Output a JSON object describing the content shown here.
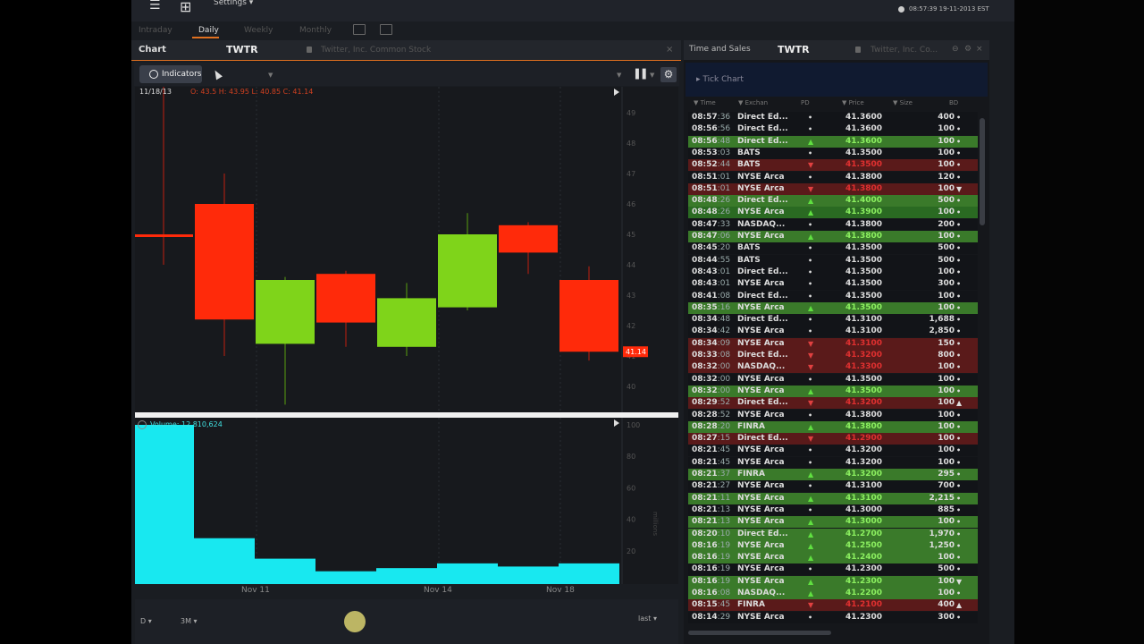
{
  "topbar": {
    "settings_label": "Settings",
    "clock": "08:57:39 19-11-2013 EST"
  },
  "range_tabs": [
    "Intraday",
    "Daily",
    "Weekly",
    "Monthly"
  ],
  "chart_panel": {
    "title": "Chart",
    "symbol": "TWTR",
    "description": "Twitter, Inc. Common Stock",
    "indicators_label": "Indicators",
    "date": "11/18/13",
    "ohlc": "O: 43.5 H: 43.95 L: 40.85 C: 41.14",
    "volume_label": "Volume: 12,810,624",
    "last_price_tag": "41.14",
    "x_labels": [
      "Nov 11",
      "Nov 14",
      "Nov 18"
    ],
    "volume_ticks": [
      "100",
      "80",
      "60",
      "40",
      "20"
    ],
    "volume_unit": "millions",
    "price_ticks": [
      "49",
      "48",
      "47",
      "46",
      "45",
      "44",
      "43",
      "42",
      "41",
      "40"
    ],
    "period_select": "D",
    "range_select": "3M",
    "mode_select": "last"
  },
  "chart_data": {
    "type": "candlestick",
    "ylim": [
      39.5,
      49.5
    ],
    "candles": [
      {
        "o": 45.0,
        "h": 50.0,
        "l": 44.0,
        "c": 45.0
      },
      {
        "o": 46.0,
        "h": 47.0,
        "l": 41.0,
        "c": 42.2
      },
      {
        "o": 41.4,
        "h": 43.6,
        "l": 39.4,
        "c": 43.5
      },
      {
        "o": 43.7,
        "h": 43.8,
        "l": 41.3,
        "c": 42.1
      },
      {
        "o": 41.3,
        "h": 43.4,
        "l": 41.0,
        "c": 42.9
      },
      {
        "o": 42.6,
        "h": 45.7,
        "l": 42.5,
        "c": 45.0
      },
      {
        "o": 45.3,
        "h": 45.4,
        "l": 43.7,
        "c": 44.4
      },
      {
        "o": 43.5,
        "h": 43.95,
        "l": 40.85,
        "c": 41.14
      }
    ],
    "volume": [
      100,
      28,
      15,
      7,
      9,
      12,
      10,
      12
    ]
  },
  "ts_panel": {
    "title": "Time and Sales",
    "symbol": "TWTR",
    "description": "Twitter, Inc. Co...",
    "tick_chart": "Tick Chart",
    "columns": [
      "Time",
      "Exchan",
      "PD",
      "Price",
      "Size",
      "BD"
    ],
    "rows": [
      {
        "t": "08:57",
        "s": ":36",
        "ex": "Direct Ed...",
        "pd": "•",
        "price": "41.3600",
        "size": "400",
        "bd": "•",
        "k": "nm"
      },
      {
        "t": "08:56",
        "s": ":56",
        "ex": "Direct Ed...",
        "pd": "•",
        "price": "41.3600",
        "size": "100",
        "bd": "•",
        "k": "nm"
      },
      {
        "t": "08:56",
        "s": ":48",
        "ex": "Direct Ed...",
        "pd": "▲",
        "price": "41.3600",
        "size": "100",
        "bd": "•",
        "k": "upB"
      },
      {
        "t": "08:53",
        "s": ":03",
        "ex": "BATS",
        "pd": "•",
        "price": "41.3500",
        "size": "100",
        "bd": "•",
        "k": "nm"
      },
      {
        "t": "08:52",
        "s": ":44",
        "ex": "BATS",
        "pd": "▼",
        "price": "41.3500",
        "size": "100",
        "bd": "•",
        "k": "dn"
      },
      {
        "t": "08:51",
        "s": ":01",
        "ex": "NYSE Arca",
        "pd": "•",
        "price": "41.3800",
        "size": "120",
        "bd": "•",
        "k": "nm"
      },
      {
        "t": "08:51",
        "s": ":01",
        "ex": "NYSE Arca",
        "pd": "▼",
        "price": "41.3800",
        "size": "100",
        "bd": "▼",
        "k": "dn"
      },
      {
        "t": "08:48",
        "s": ":26",
        "ex": "Direct Ed...",
        "pd": "▲",
        "price": "41.4000",
        "size": "500",
        "bd": "•",
        "k": "upB"
      },
      {
        "t": "08:48",
        "s": ":26",
        "ex": "NYSE Arca",
        "pd": "▲",
        "price": "41.3900",
        "size": "100",
        "bd": "•",
        "k": "up"
      },
      {
        "t": "08:47",
        "s": ":33",
        "ex": "NASDAQ...",
        "pd": "•",
        "price": "41.3800",
        "size": "200",
        "bd": "•",
        "k": "nm"
      },
      {
        "t": "08:47",
        "s": ":06",
        "ex": "NYSE Arca",
        "pd": "▲",
        "price": "41.3800",
        "size": "100",
        "bd": "•",
        "k": "upB"
      },
      {
        "t": "08:45",
        "s": ":20",
        "ex": "BATS",
        "pd": "•",
        "price": "41.3500",
        "size": "500",
        "bd": "•",
        "k": "nm"
      },
      {
        "t": "08:44",
        "s": ":55",
        "ex": "BATS",
        "pd": "•",
        "price": "41.3500",
        "size": "500",
        "bd": "•",
        "k": "nm"
      },
      {
        "t": "08:43",
        "s": ":01",
        "ex": "Direct Ed...",
        "pd": "•",
        "price": "41.3500",
        "size": "100",
        "bd": "•",
        "k": "nm"
      },
      {
        "t": "08:43",
        "s": ":01",
        "ex": "NYSE Arca",
        "pd": "•",
        "price": "41.3500",
        "size": "300",
        "bd": "•",
        "k": "nm"
      },
      {
        "t": "08:41",
        "s": ":08",
        "ex": "Direct Ed...",
        "pd": "•",
        "price": "41.3500",
        "size": "100",
        "bd": "•",
        "k": "nm"
      },
      {
        "t": "08:35",
        "s": ":16",
        "ex": "NYSE Arca",
        "pd": "▲",
        "price": "41.3500",
        "size": "100",
        "bd": "•",
        "k": "upB"
      },
      {
        "t": "08:34",
        "s": ":48",
        "ex": "Direct Ed...",
        "pd": "•",
        "price": "41.3100",
        "size": "1,688",
        "bd": "•",
        "k": "nm"
      },
      {
        "t": "08:34",
        "s": ":42",
        "ex": "NYSE Arca",
        "pd": "•",
        "price": "41.3100",
        "size": "2,850",
        "bd": "•",
        "k": "nm"
      },
      {
        "t": "08:34",
        "s": ":09",
        "ex": "NYSE Arca",
        "pd": "▼",
        "price": "41.3100",
        "size": "150",
        "bd": "•",
        "k": "dn"
      },
      {
        "t": "08:33",
        "s": ":08",
        "ex": "Direct Ed...",
        "pd": "▼",
        "price": "41.3200",
        "size": "800",
        "bd": "•",
        "k": "dn"
      },
      {
        "t": "08:32",
        "s": ":00",
        "ex": "NASDAQ...",
        "pd": "▼",
        "price": "41.3300",
        "size": "100",
        "bd": "•",
        "k": "dn"
      },
      {
        "t": "08:32",
        "s": ":00",
        "ex": "NYSE Arca",
        "pd": "•",
        "price": "41.3500",
        "size": "100",
        "bd": "•",
        "k": "nm"
      },
      {
        "t": "08:32",
        "s": ":00",
        "ex": "NYSE Arca",
        "pd": "▲",
        "price": "41.3500",
        "size": "100",
        "bd": "•",
        "k": "upB"
      },
      {
        "t": "08:29",
        "s": ":52",
        "ex": "Direct Ed...",
        "pd": "▼",
        "price": "41.3200",
        "size": "100",
        "bd": "▲",
        "k": "dn"
      },
      {
        "t": "08:28",
        "s": ":52",
        "ex": "NYSE Arca",
        "pd": "•",
        "price": "41.3800",
        "size": "100",
        "bd": "•",
        "k": "nm"
      },
      {
        "t": "08:28",
        "s": ":20",
        "ex": "FINRA",
        "pd": "▲",
        "price": "41.3800",
        "size": "100",
        "bd": "•",
        "k": "upB"
      },
      {
        "t": "08:27",
        "s": ":15",
        "ex": "Direct Ed...",
        "pd": "▼",
        "price": "41.2900",
        "size": "100",
        "bd": "•",
        "k": "dn"
      },
      {
        "t": "08:21",
        "s": ":45",
        "ex": "NYSE Arca",
        "pd": "•",
        "price": "41.3200",
        "size": "100",
        "bd": "•",
        "k": "nm"
      },
      {
        "t": "08:21",
        "s": ":45",
        "ex": "NYSE Arca",
        "pd": "•",
        "price": "41.3200",
        "size": "100",
        "bd": "•",
        "k": "nm"
      },
      {
        "t": "08:21",
        "s": ":37",
        "ex": "FINRA",
        "pd": "▲",
        "price": "41.3200",
        "size": "295",
        "bd": "•",
        "k": "upB"
      },
      {
        "t": "08:21",
        "s": ":27",
        "ex": "NYSE Arca",
        "pd": "•",
        "price": "41.3100",
        "size": "700",
        "bd": "•",
        "k": "nm"
      },
      {
        "t": "08:21",
        "s": ":11",
        "ex": "NYSE Arca",
        "pd": "▲",
        "price": "41.3100",
        "size": "2,215",
        "bd": "•",
        "k": "upB"
      },
      {
        "t": "08:21",
        "s": ":13",
        "ex": "NYSE Arca",
        "pd": "•",
        "price": "41.3000",
        "size": "885",
        "bd": "•",
        "k": "nm"
      },
      {
        "t": "08:21",
        "s": ":13",
        "ex": "NYSE Arca",
        "pd": "▲",
        "price": "41.3000",
        "size": "100",
        "bd": "•",
        "k": "upB"
      },
      {
        "t": "08:20",
        "s": ":10",
        "ex": "Direct Ed...",
        "pd": "▲",
        "price": "41.2700",
        "size": "1,970",
        "bd": "•",
        "k": "upB"
      },
      {
        "t": "08:16",
        "s": ":19",
        "ex": "NYSE Arca",
        "pd": "▲",
        "price": "41.2500",
        "size": "1,250",
        "bd": "•",
        "k": "upB"
      },
      {
        "t": "08:16",
        "s": ":19",
        "ex": "NYSE Arca",
        "pd": "▲",
        "price": "41.2400",
        "size": "100",
        "bd": "•",
        "k": "upB"
      },
      {
        "t": "08:16",
        "s": ":19",
        "ex": "NYSE Arca",
        "pd": "•",
        "price": "41.2300",
        "size": "500",
        "bd": "•",
        "k": "nm"
      },
      {
        "t": "08:16",
        "s": ":19",
        "ex": "NYSE Arca",
        "pd": "▲",
        "price": "41.2300",
        "size": "100",
        "bd": "▼",
        "k": "upB"
      },
      {
        "t": "08:16",
        "s": ":08",
        "ex": "NASDAQ...",
        "pd": "▲",
        "price": "41.2200",
        "size": "100",
        "bd": "•",
        "k": "upB"
      },
      {
        "t": "08:15",
        "s": ":45",
        "ex": "FINRA",
        "pd": "▼",
        "price": "41.2100",
        "size": "400",
        "bd": "▲",
        "k": "dn"
      },
      {
        "t": "08:14",
        "s": ":29",
        "ex": "NYSE Arca",
        "pd": "•",
        "price": "41.2300",
        "size": "300",
        "bd": "•",
        "k": "nm"
      }
    ]
  },
  "colors": {
    "up": "#7fd41a",
    "down": "#ff2a0a",
    "volume": "#18e8f0",
    "accent": "#e07020"
  }
}
